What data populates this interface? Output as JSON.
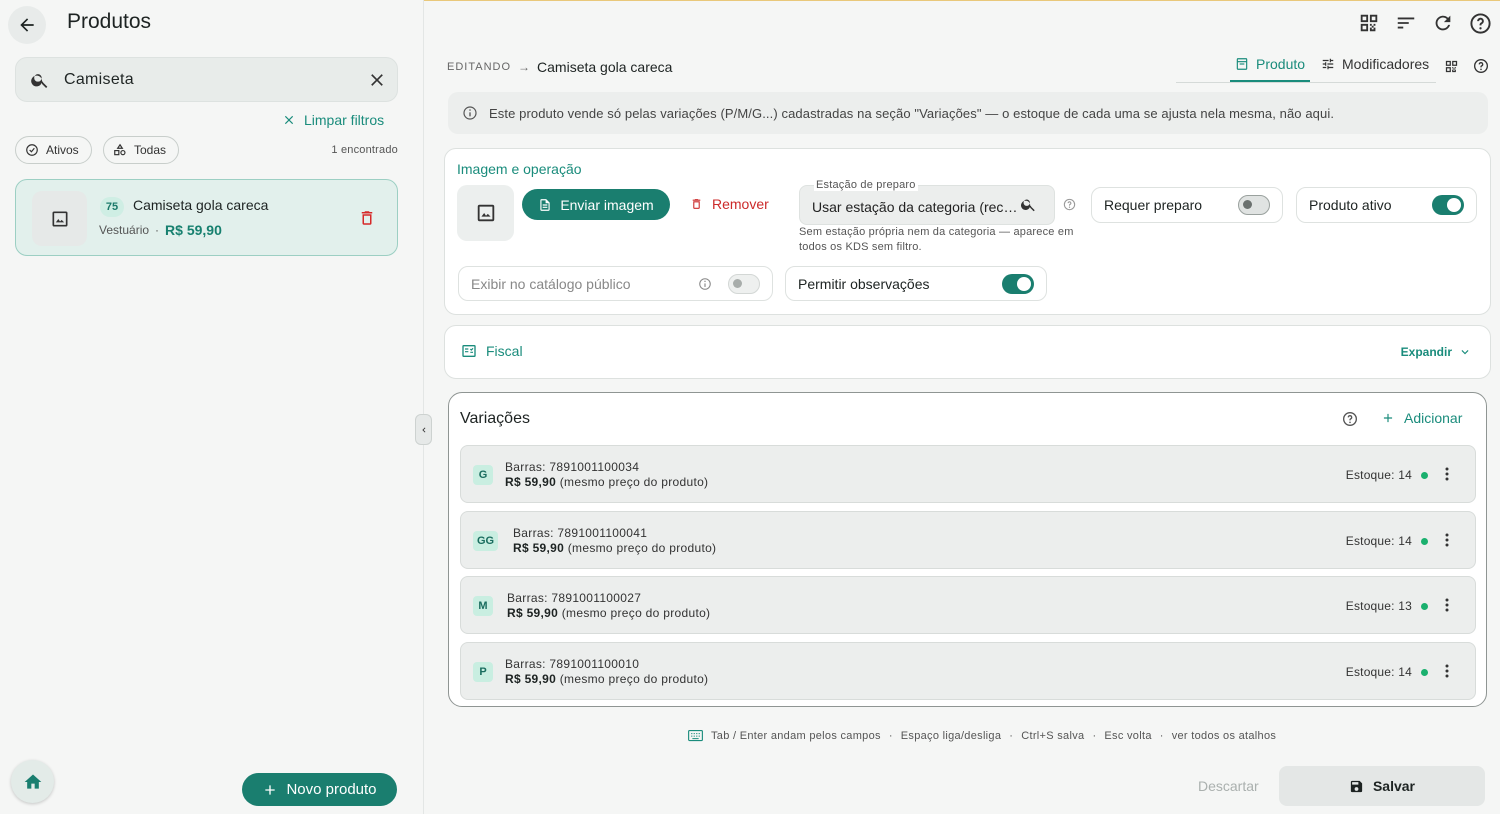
{
  "header": {
    "title": "Produtos"
  },
  "search": {
    "value": "Camiseta",
    "placeholder": ""
  },
  "filters": {
    "clear_label": "Limpar filtros",
    "chip_active": "Ativos",
    "chip_all": "Todas",
    "count": "1 encontrado"
  },
  "product_list": [
    {
      "badge": "75",
      "name": "Camiseta gola careca",
      "category": "Vestuário",
      "separator": "·",
      "price": "R$ 59,90"
    }
  ],
  "left_footer": {
    "new_product_label": "Novo produto"
  },
  "editor": {
    "editing_label": "EDITANDO",
    "arrow": "→",
    "product_name": "Camiseta gola careca",
    "tabs": [
      {
        "label": "Produto",
        "active": true
      },
      {
        "label": "Modificadores",
        "active": false
      }
    ],
    "info_text": "Este produto vende só pelas variações (P/M/G...) cadastradas na seção \"Variações\" — o estoque de cada uma se ajusta nela mesma, não aqui."
  },
  "image_section": {
    "title": "Imagem e operação",
    "send_label": "Enviar imagem",
    "remove_label": "Remover",
    "station_label": "Estação de preparo",
    "station_value": "Usar estação da categoria (recomendado)",
    "station_help": "Sem estação própria nem da categoria — aparece em todos os KDS sem filtro.",
    "requires_prep_label": "Requer preparo",
    "requires_prep": false,
    "active_label": "Produto ativo",
    "active": true,
    "catalog_label": "Exibir no catálogo público",
    "catalog": false,
    "notes_label": "Permitir observações",
    "notes": true
  },
  "fiscal": {
    "title": "Fiscal",
    "expand_label": "Expandir"
  },
  "variations": {
    "title": "Variações",
    "add_label": "Adicionar",
    "rows": [
      {
        "size": "G",
        "barcode": "Barras: 7891001100034",
        "price": "R$ 59,90",
        "price_note": "(mesmo preço do produto)",
        "stock": "Estoque: 14"
      },
      {
        "size": "GG",
        "barcode": "Barras: 7891001100041",
        "price": "R$ 59,90",
        "price_note": "(mesmo preço do produto)",
        "stock": "Estoque: 14"
      },
      {
        "size": "M",
        "barcode": "Barras: 7891001100027",
        "price": "R$ 59,90",
        "price_note": "(mesmo preço do produto)",
        "stock": "Estoque: 13"
      },
      {
        "size": "P",
        "barcode": "Barras: 7891001100010",
        "price": "R$ 59,90",
        "price_note": "(mesmo preço do produto)",
        "stock": "Estoque: 14"
      }
    ]
  },
  "shortcuts": {
    "tab_enter": "Tab / Enter andam pelos campos",
    "space": "Espaço liga/desliga",
    "ctrl_s": "Ctrl+S salva",
    "esc": "Esc volta",
    "all": "ver todos os atalhos",
    "sep": "·"
  },
  "footer": {
    "discard_label": "Descartar",
    "save_label": "Salvar"
  },
  "colors": {
    "accent": "#1a7e6f",
    "accent_text": "#1a8c7c",
    "danger": "#cc2a2a",
    "stock_dot": "#1ab06e"
  },
  "icons": [
    "back-arrow-icon",
    "search-icon",
    "close-icon",
    "check-circle-icon",
    "shapes-icon",
    "image-icon",
    "trash-icon",
    "home-icon",
    "plus-icon",
    "qr-code-icon",
    "sort-icon",
    "refresh-icon",
    "help-icon",
    "info-icon",
    "upload-file-icon",
    "fiscal-icon",
    "chevron-down-icon",
    "chevron-left-icon",
    "kebab-icon",
    "keyboard-icon",
    "save-icon",
    "tune-icon",
    "product-icon"
  ]
}
